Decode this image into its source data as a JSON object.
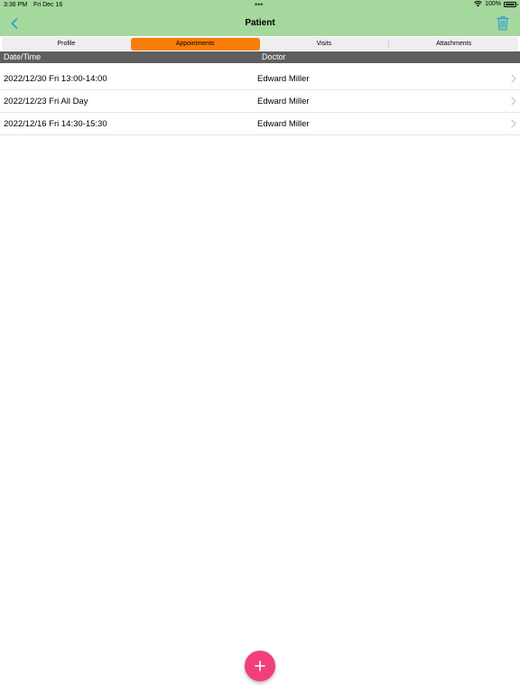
{
  "status_bar": {
    "time": "3:36 PM",
    "date": "Fri Dec 16",
    "multitask_dots": "•••",
    "battery_text": "100%",
    "wifi_icon": "wifi-icon",
    "battery_icon": "battery-icon"
  },
  "nav": {
    "title": "Patient",
    "back_icon": "chevron-left-icon",
    "delete_icon": "trash-icon",
    "background_color": "#a4d89c",
    "accent_color": "#2a9cd8"
  },
  "tabs": {
    "active_color": "#fb7d09",
    "items": [
      {
        "label": "Profile",
        "active": false
      },
      {
        "label": "Appointments",
        "active": true
      },
      {
        "label": "Visits",
        "active": false
      },
      {
        "label": "Attachments",
        "active": false
      }
    ]
  },
  "table": {
    "header_color": "#5f5f5f",
    "columns": [
      "Date/Time",
      "Doctor"
    ],
    "rows": [
      {
        "datetime": "2022/12/30 Fri 13:00-14:00",
        "doctor": "Edward Miller"
      },
      {
        "datetime": "2022/12/23 Fri All Day",
        "doctor": "Edward Miller"
      },
      {
        "datetime": "2022/12/16 Fri 14:30-15:30",
        "doctor": "Edward Miller"
      }
    ]
  },
  "fab": {
    "icon": "plus-icon",
    "color": "#f23f7c"
  }
}
